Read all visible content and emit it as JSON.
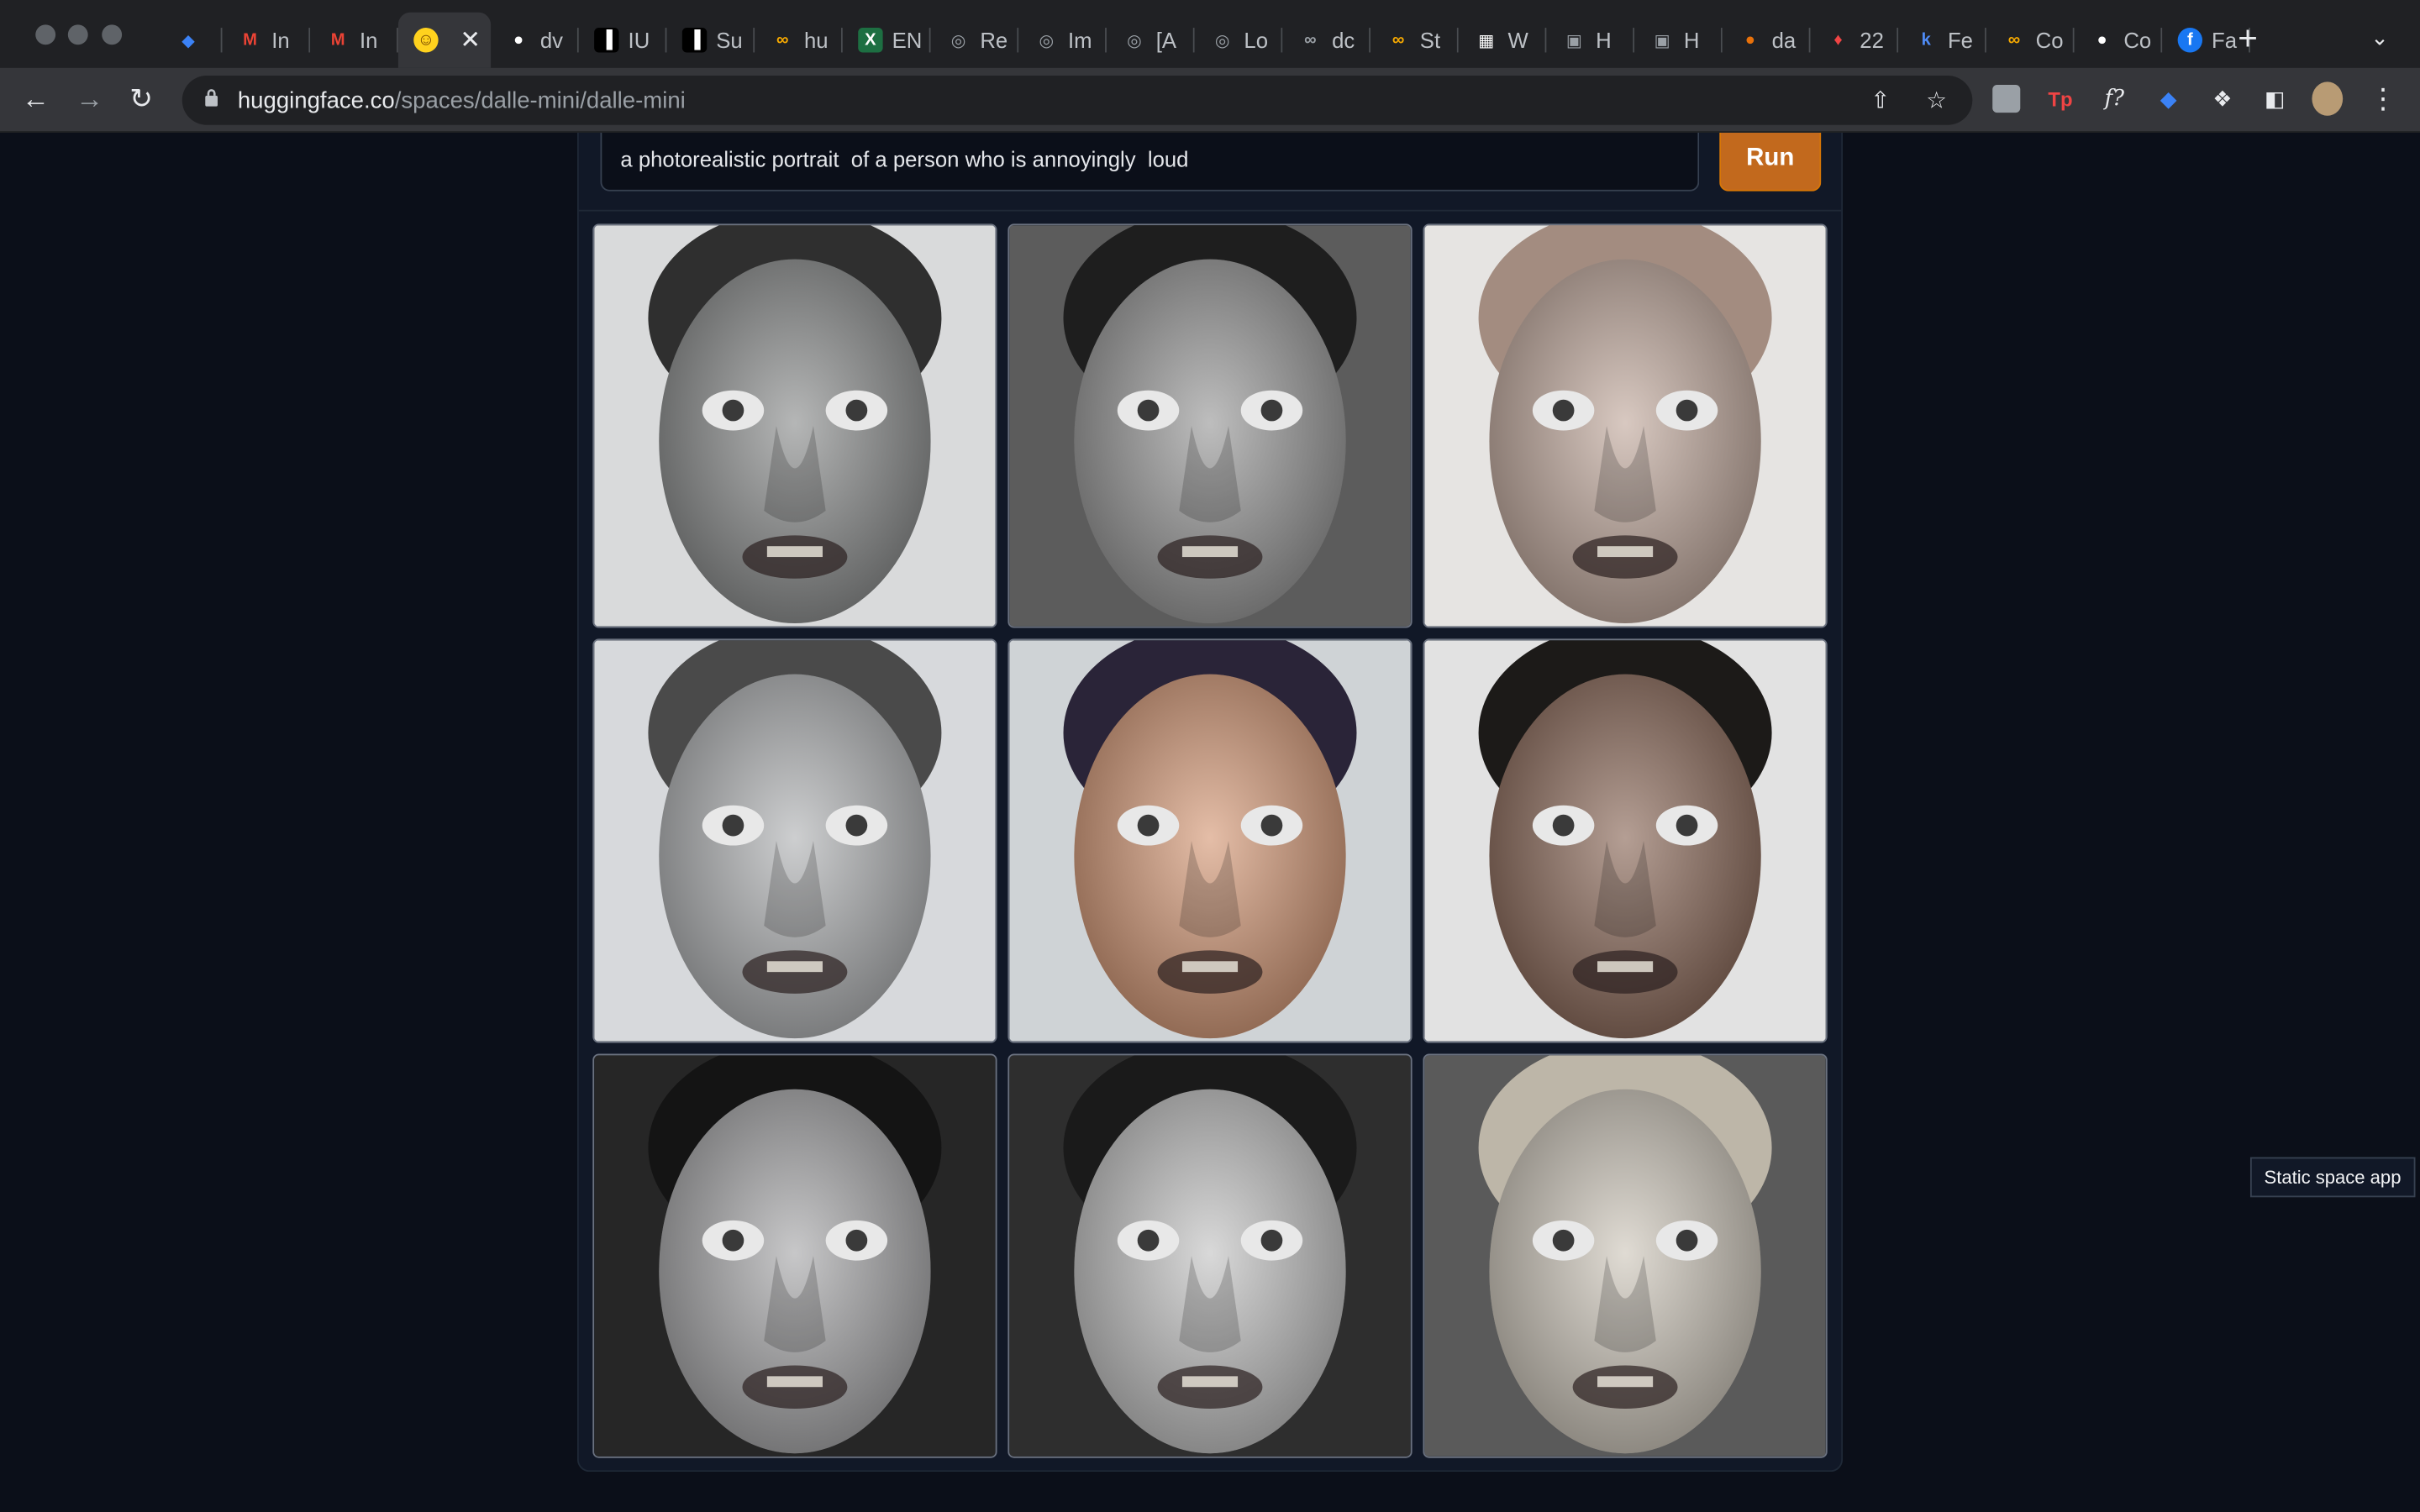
{
  "browser": {
    "tabs": [
      {
        "label": "",
        "icon": "diamond-icon",
        "color": "#3b82f6"
      },
      {
        "label": "In",
        "icon": "gmail-icon",
        "color": "#ea4335"
      },
      {
        "label": "In",
        "icon": "gmail-icon",
        "color": "#ea4335"
      },
      {
        "label": "",
        "icon": "huggingface-icon",
        "color": "#ffd21e",
        "active": true
      },
      {
        "label": "dv",
        "icon": "github-icon",
        "color": "#ffffff"
      },
      {
        "label": "IU",
        "icon": "notion-icon",
        "color": "#000000"
      },
      {
        "label": "Su",
        "icon": "notion-icon",
        "color": "#000000"
      },
      {
        "label": "hu",
        "icon": "colab-icon",
        "color": "#f9ab00"
      },
      {
        "label": "EN",
        "icon": "excel-icon",
        "color": "#1d6f42"
      },
      {
        "label": "Re",
        "icon": "globe-icon",
        "color": "#9aa0a6"
      },
      {
        "label": "Im",
        "icon": "globe-icon",
        "color": "#9aa0a6"
      },
      {
        "label": "[A",
        "icon": "globe-icon",
        "color": "#9aa0a6"
      },
      {
        "label": "Lo",
        "icon": "globe-icon",
        "color": "#9aa0a6"
      },
      {
        "label": "dc",
        "icon": "infinity-icon",
        "color": "#9aa0a6"
      },
      {
        "label": "St",
        "icon": "colab-icon",
        "color": "#f9ab00"
      },
      {
        "label": "W",
        "icon": "qr-icon",
        "color": "#ffffff"
      },
      {
        "label": "H",
        "icon": "image-icon",
        "color": "#9aa0a6"
      },
      {
        "label": "H",
        "icon": "image-icon",
        "color": "#9aa0a6"
      },
      {
        "label": "da",
        "icon": "fire-badge-icon",
        "color": "#e8710a"
      },
      {
        "label": "22",
        "icon": "flame-icon",
        "color": "#ef4444"
      },
      {
        "label": "Fe",
        "icon": "k-icon",
        "color": "#4f8cf7"
      },
      {
        "label": "Co",
        "icon": "colab-icon",
        "color": "#f9ab00"
      },
      {
        "label": "Co",
        "icon": "github-icon",
        "color": "#ffffff"
      },
      {
        "label": "Fa",
        "icon": "facebook-icon",
        "color": "#1877f2"
      }
    ],
    "url_host": "huggingface.co",
    "url_path": "/spaces/dalle-mini/dalle-mini"
  },
  "app": {
    "prompt_text": "a photorealistic portrait  of a person who is annoyingly  loud",
    "run_label": "Run",
    "accent": "#c2691d",
    "results": [
      {
        "skin": "#8d8f8f",
        "bg": "#d9dadb",
        "hair": "#2f2f2f"
      },
      {
        "skin": "#9a9a9a",
        "bg": "#5c5c5c",
        "hair": "#1e1e1e"
      },
      {
        "skin": "#c3ab9f",
        "bg": "#e6e4e2",
        "hair": "#a38c80"
      },
      {
        "skin": "#b2b4b6",
        "bg": "#d7d9dc",
        "hair": "#4a4a4a"
      },
      {
        "skin": "#d69a78",
        "bg": "#cfd3d6",
        "hair": "#2a2438"
      },
      {
        "skin": "#8c6a5a",
        "bg": "#e2e2e2",
        "hair": "#1c1a18"
      },
      {
        "skin": "#a9a9ab",
        "bg": "#262626",
        "hair": "#141414"
      },
      {
        "skin": "#c4c4c4",
        "bg": "#2e2e2e",
        "hair": "#1a1a1a"
      },
      {
        "skin": "#cfc8bc",
        "bg": "#5a5a5a",
        "hair": "#bdb6a8"
      }
    ]
  },
  "tooltip": "Static space app"
}
